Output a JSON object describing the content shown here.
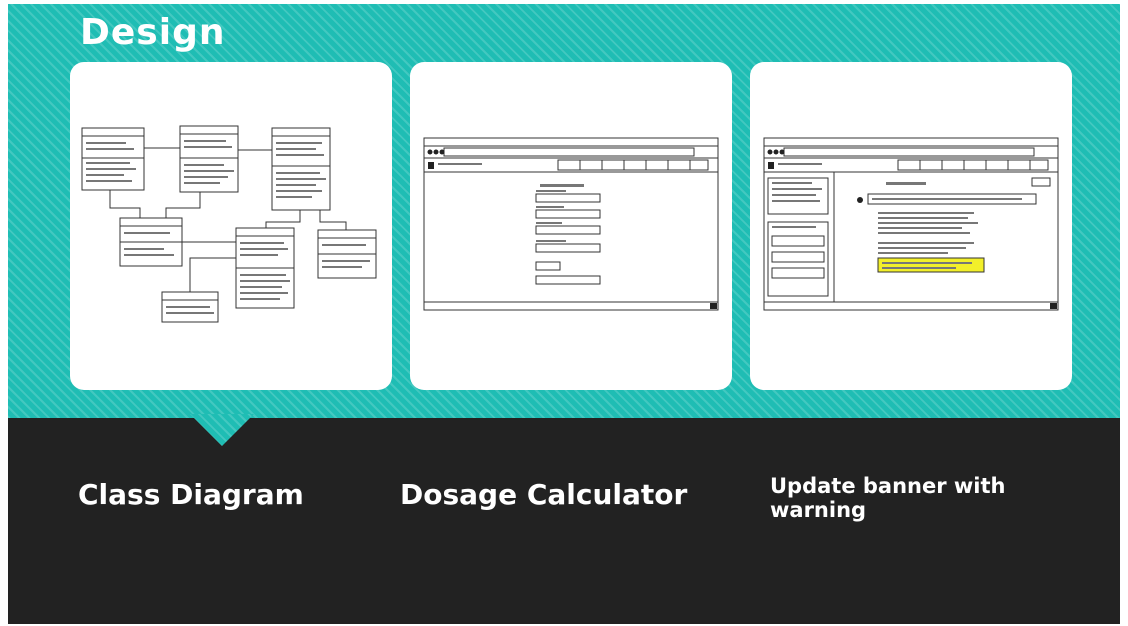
{
  "slide": {
    "title": "Design",
    "accent_color": "#1fbdb4",
    "dark_color": "#222222"
  },
  "cards": [
    {
      "caption": "Class Diagram"
    },
    {
      "caption": "Dosage Calculator"
    },
    {
      "caption": "Update banner with warning"
    }
  ]
}
